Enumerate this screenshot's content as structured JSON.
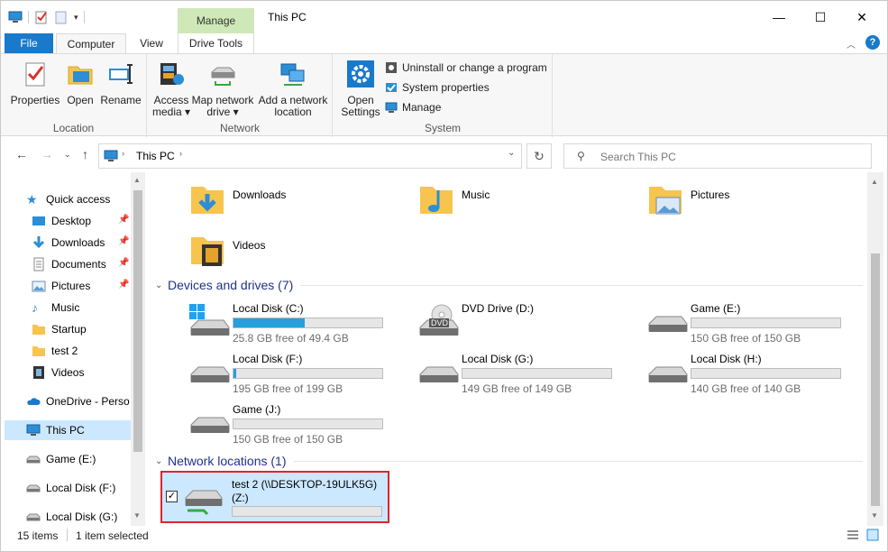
{
  "window": {
    "title": "This PC",
    "contextual_tab": "Manage",
    "controls": {
      "minimize": "—",
      "maximize": "☐",
      "close": "✕"
    }
  },
  "tabs": [
    {
      "label": "File"
    },
    {
      "label": "Computer"
    },
    {
      "label": "View"
    },
    {
      "label": "Drive Tools"
    }
  ],
  "ribbon": {
    "location": {
      "label": "Location",
      "buttons": [
        "Properties",
        "Open",
        "Rename"
      ]
    },
    "network": {
      "label": "Network",
      "access_media": [
        "Access",
        "media ▾"
      ],
      "map_drive": [
        "Map network",
        "drive ▾"
      ],
      "add_location": [
        "Add a network",
        "location"
      ]
    },
    "system": {
      "label": "System",
      "open_settings": [
        "Open",
        "Settings"
      ],
      "uninstall": "Uninstall or change a program",
      "system_properties": "System properties",
      "manage": "Manage"
    }
  },
  "address": {
    "path_root": "This PC",
    "search_placeholder": "Search This PC"
  },
  "sidebar": {
    "quick_access": "Quick access",
    "items": [
      "Desktop",
      "Downloads",
      "Documents",
      "Pictures",
      "Music",
      "Startup",
      "test 2",
      "Videos"
    ],
    "onedrive": "OneDrive - Person",
    "this_pc": "This PC",
    "drives": [
      "Game (E:)",
      "Local Disk (F:)",
      "Local Disk (G:)"
    ]
  },
  "folders": [
    "Downloads",
    "Music",
    "Pictures",
    "Videos"
  ],
  "devices_section": "Devices and drives (7)",
  "drives": [
    {
      "name": "Local Disk (C:)",
      "free": "25.8 GB free of 49.4 GB",
      "used_fraction": 0.48
    },
    {
      "name": "DVD Drive (D:)",
      "free": "",
      "used_fraction": null
    },
    {
      "name": "Game (E:)",
      "free": "150 GB free of 150 GB",
      "used_fraction": 0.0
    },
    {
      "name": "Local Disk (F:)",
      "free": "195 GB free of 199 GB",
      "used_fraction": 0.02
    },
    {
      "name": "Local Disk (G:)",
      "free": "149 GB free of 149 GB",
      "used_fraction": 0.0
    },
    {
      "name": "Local Disk (H:)",
      "free": "140 GB free of 140 GB",
      "used_fraction": 0.0
    },
    {
      "name": "Game (J:)",
      "free": "150 GB free of 150 GB",
      "used_fraction": 0.0
    }
  ],
  "dvd_badge": "DVD",
  "network_section": "Network locations (1)",
  "network_location": {
    "name_line1": "test 2 (\\\\DESKTOP-19ULK5G)",
    "name_line2": "(Z:)",
    "used_fraction": 0.0
  },
  "status": {
    "items": "15 items",
    "selected": "1 item selected"
  }
}
